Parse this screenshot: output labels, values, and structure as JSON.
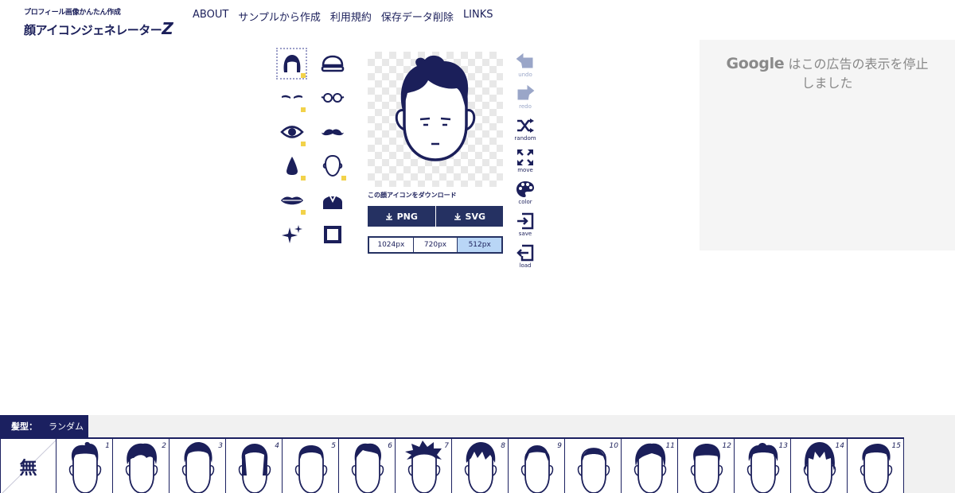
{
  "header": {
    "logo_sub": "プロフィール画像かんたん作成",
    "logo_main": "顔アイコンジェネレーター",
    "logo_z": "Z",
    "nav": [
      "ABOUT",
      "サンプルから作成",
      "利用規約",
      "保存データ削除",
      "LINKS"
    ]
  },
  "parts": [
    {
      "name": "hair",
      "icon": "hair-icon",
      "flag": true,
      "selected": true
    },
    {
      "name": "hat",
      "icon": "hat-icon",
      "flag": false
    },
    {
      "name": "eyebrows",
      "icon": "eyebrows-icon",
      "flag": true
    },
    {
      "name": "glasses",
      "icon": "glasses-icon",
      "flag": false
    },
    {
      "name": "eyes",
      "icon": "eye-icon",
      "flag": true
    },
    {
      "name": "mustache",
      "icon": "mustache-icon",
      "flag": false
    },
    {
      "name": "nose",
      "icon": "nose-icon",
      "flag": true
    },
    {
      "name": "face-outline",
      "icon": "face-outline-icon",
      "flag": true
    },
    {
      "name": "mouth",
      "icon": "lips-icon",
      "flag": true
    },
    {
      "name": "clothes",
      "icon": "suit-icon",
      "flag": false
    },
    {
      "name": "effects",
      "icon": "sparkle-icon",
      "flag": false
    },
    {
      "name": "background",
      "icon": "frame-icon",
      "flag": false
    }
  ],
  "download": {
    "caption": "この顔アイコンをダウンロード",
    "png_label": "PNG",
    "svg_label": "SVG",
    "sizes": [
      "1024px",
      "720px",
      "512px"
    ],
    "active_size": "512px"
  },
  "tools": [
    {
      "label": "undo",
      "icon": "undo-icon",
      "disabled": true
    },
    {
      "label": "redo",
      "icon": "redo-icon",
      "disabled": true
    },
    {
      "label": "random",
      "icon": "shuffle-icon",
      "disabled": false
    },
    {
      "label": "move",
      "icon": "move-icon",
      "disabled": false
    },
    {
      "label": "color",
      "icon": "palette-icon",
      "disabled": false
    },
    {
      "label": "save",
      "icon": "save-icon",
      "disabled": false
    },
    {
      "label": "load",
      "icon": "load-icon",
      "disabled": false
    }
  ],
  "ad": {
    "google": "Google",
    "line1": "はこの広告の表示を停止",
    "line2": "しました"
  },
  "selector": {
    "category": "髪型：",
    "random_label": "ランダム",
    "none_label": "無",
    "items": [
      "1",
      "2",
      "3",
      "4",
      "5",
      "6",
      "7",
      "8",
      "9",
      "10",
      "11",
      "12",
      "13",
      "14",
      "15"
    ]
  },
  "colors": {
    "navy": "#1b1f5a",
    "button": "#253162",
    "active_size": "#b9d6f6",
    "flag": "#f2d24a"
  }
}
